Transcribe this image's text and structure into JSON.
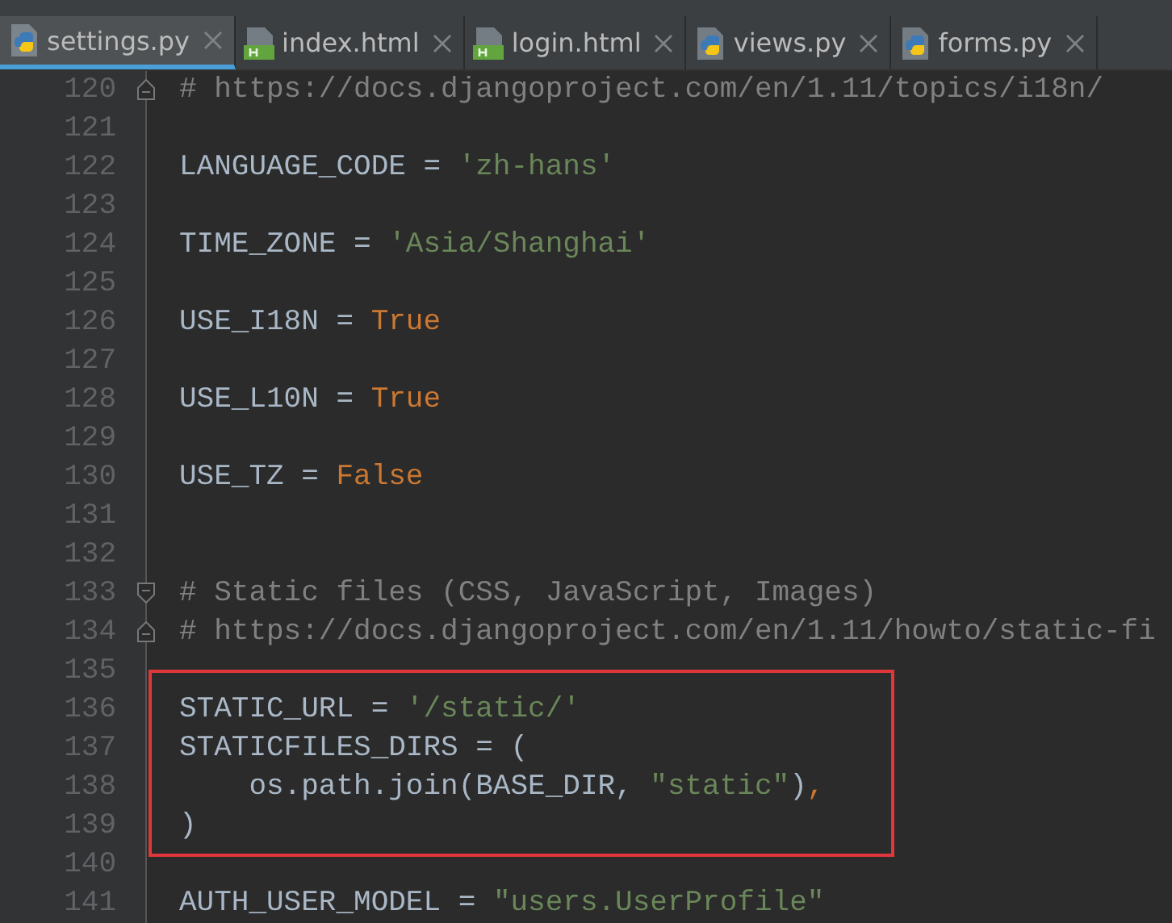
{
  "tabs": [
    {
      "label": "settings.py",
      "kind": "python",
      "selected": true
    },
    {
      "label": "index.html",
      "kind": "html",
      "selected": false
    },
    {
      "label": "login.html",
      "kind": "html",
      "selected": false
    },
    {
      "label": "views.py",
      "kind": "python",
      "selected": false
    },
    {
      "label": "forms.py",
      "kind": "python",
      "selected": false
    }
  ],
  "lines": [
    {
      "number": "120",
      "fold": {
        "kind": "end"
      },
      "boxed": false,
      "tokens": [
        {
          "kind": "comment",
          "text": "# https://docs.djangoproject.com/en/1.11/topics/i18n/"
        }
      ]
    },
    {
      "number": "121",
      "boxed": false
    },
    {
      "number": "122",
      "boxed": false,
      "tokens": [
        {
          "kind": "plain",
          "text": "LANGUAGE_CODE = "
        },
        {
          "kind": "string",
          "text": "'zh-hans'"
        }
      ]
    },
    {
      "number": "123",
      "boxed": false
    },
    {
      "number": "124",
      "boxed": false,
      "tokens": [
        {
          "kind": "plain",
          "text": "TIME_ZONE = "
        },
        {
          "kind": "string",
          "text": "'Asia/Shanghai'"
        }
      ]
    },
    {
      "number": "125",
      "boxed": false
    },
    {
      "number": "126",
      "boxed": false,
      "tokens": [
        {
          "kind": "plain",
          "text": "USE_I18N = "
        },
        {
          "kind": "keyword",
          "text": "True"
        }
      ]
    },
    {
      "number": "127",
      "boxed": false
    },
    {
      "number": "128",
      "boxed": false,
      "tokens": [
        {
          "kind": "plain",
          "text": "USE_L10N = "
        },
        {
          "kind": "keyword",
          "text": "True"
        }
      ]
    },
    {
      "number": "129",
      "boxed": false
    },
    {
      "number": "130",
      "boxed": false,
      "tokens": [
        {
          "kind": "plain",
          "text": "USE_TZ = "
        },
        {
          "kind": "keyword",
          "text": "False"
        }
      ]
    },
    {
      "number": "131",
      "boxed": false
    },
    {
      "number": "132",
      "boxed": false
    },
    {
      "number": "133",
      "fold": {
        "kind": "start"
      },
      "boxed": false,
      "tokens": [
        {
          "kind": "comment",
          "text": "# Static files (CSS, JavaScript, Images)"
        }
      ]
    },
    {
      "number": "134",
      "fold": {
        "kind": "end"
      },
      "boxed": false,
      "tokens": [
        {
          "kind": "comment",
          "text": "# https://docs.djangoproject.com/en/1.11/howto/static-fi"
        }
      ]
    },
    {
      "number": "135",
      "boxed": false
    },
    {
      "number": "136",
      "boxed": true,
      "tokens": [
        {
          "kind": "plain",
          "text": "STATIC_URL = "
        },
        {
          "kind": "string",
          "text": "'/static/'"
        }
      ]
    },
    {
      "number": "137",
      "boxed": true,
      "tokens": [
        {
          "kind": "plain",
          "text": "STATICFILES_DIRS = ("
        }
      ]
    },
    {
      "number": "138",
      "boxed": true,
      "tokens": [
        {
          "kind": "plain",
          "text": "    os.path.join(BASE_DIR, "
        },
        {
          "kind": "string",
          "text": "\"static\""
        },
        {
          "kind": "plain",
          "text": ")"
        },
        {
          "kind": "keyword",
          "text": ","
        }
      ]
    },
    {
      "number": "139",
      "boxed": true,
      "tokens": [
        {
          "kind": "plain",
          "text": ")"
        }
      ]
    },
    {
      "number": "140",
      "boxed": false
    },
    {
      "number": "141",
      "boxed": false,
      "tokens": [
        {
          "kind": "plain",
          "text": "AUTH_USER_MODEL = "
        },
        {
          "kind": "string",
          "text": "\"users.UserProfile\""
        }
      ]
    }
  ]
}
